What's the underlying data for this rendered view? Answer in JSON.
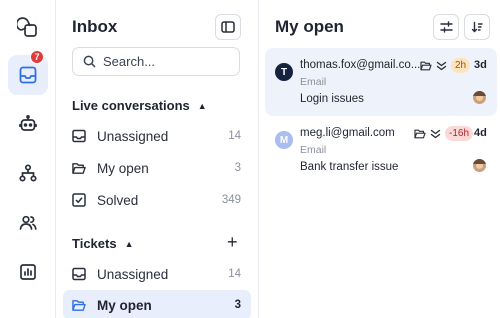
{
  "rail": {
    "items": [
      {
        "icon": "overlapping-shapes-icon"
      },
      {
        "icon": "inbox-icon",
        "badge": "7",
        "active": true
      },
      {
        "icon": "bot-icon"
      },
      {
        "icon": "org-chart-icon"
      },
      {
        "icon": "users-icon"
      },
      {
        "icon": "bar-chart-icon"
      }
    ]
  },
  "inbox": {
    "title": "Inbox",
    "search_placeholder": "Search...",
    "live_section": "Live conversations",
    "live_items": [
      {
        "label": "Unassigned",
        "count": "14",
        "icon": "tray-icon"
      },
      {
        "label": "My open",
        "count": "3",
        "icon": "folder-open-icon"
      },
      {
        "label": "Solved",
        "count": "349",
        "icon": "checkbox-icon"
      }
    ],
    "tickets_section": "Tickets",
    "ticket_items": [
      {
        "label": "Unassigned",
        "count": "14",
        "icon": "tray-icon"
      },
      {
        "label": "My open",
        "count": "3",
        "icon": "folder-open-icon",
        "active": true
      }
    ]
  },
  "open": {
    "title": "My open",
    "conversations": [
      {
        "avatar": "T",
        "avatar_color": "#15233f",
        "email": "thomas.fox@gmail.co...",
        "channel": "Email",
        "subject": "Login issues",
        "sla": "2h",
        "sla_bg": "#fde3bf",
        "sla_color": "#9a5a00",
        "age": "3d",
        "selected": true
      },
      {
        "avatar": "M",
        "avatar_color": "#a9bdf0",
        "email": "meg.li@gmail.com",
        "channel": "Email",
        "subject": "Bank transfer issue",
        "sla": "-16h",
        "sla_bg": "#fbd9d9",
        "sla_color": "#b42323",
        "age": "4d",
        "selected": false
      }
    ]
  },
  "colors": {
    "accent": "#2f6fe4",
    "active_bg": "#e8eefb",
    "badge": "#e03b3b"
  }
}
